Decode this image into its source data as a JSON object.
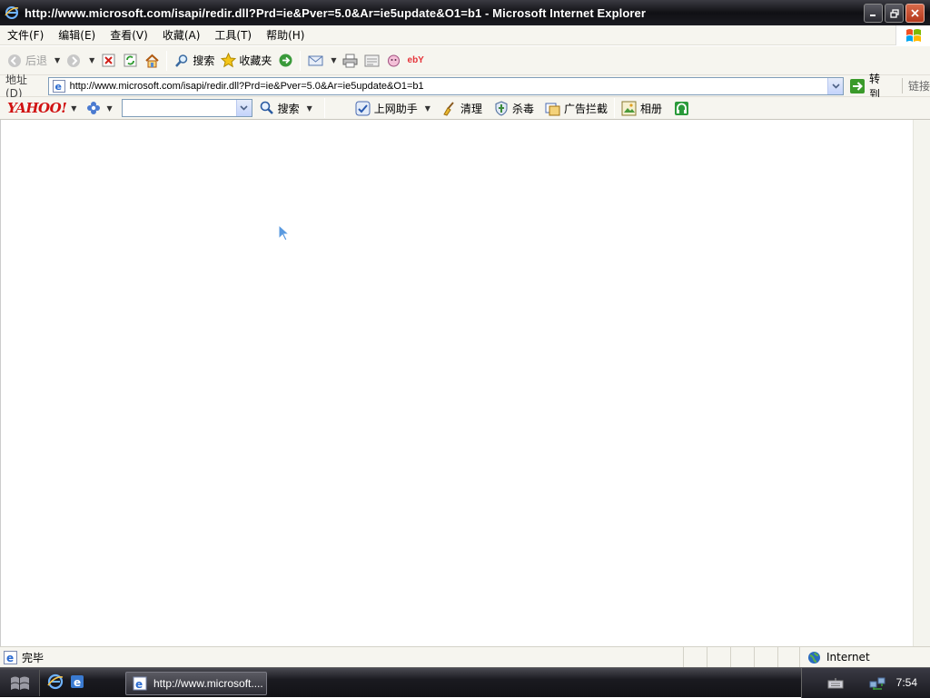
{
  "window": {
    "title": "http://www.microsoft.com/isapi/redir.dll?Prd=ie&Pver=5.0&Ar=ie5update&O1=b1 - Microsoft Internet Explorer",
    "controls": [
      "minimize",
      "maximize",
      "close"
    ]
  },
  "menu": {
    "items": [
      "文件(F)",
      "编辑(E)",
      "查看(V)",
      "收藏(A)",
      "工具(T)",
      "帮助(H)"
    ]
  },
  "toolbar": {
    "back_label": "后退",
    "search_label": "搜索",
    "favorites_label": "收藏夹",
    "ebay_label": "ebY"
  },
  "address": {
    "label": "地址(D)",
    "url": "http://www.microsoft.com/isapi/redir.dll?Prd=ie&Pver=5.0&Ar=ie5update&O1=b1",
    "go_label": "转到",
    "links_label": "链接"
  },
  "yahoo_bar": {
    "logo": "YAHOO!",
    "search_value": "",
    "search_label": "搜索",
    "assistant_label": "上网助手",
    "clean_label": "清理",
    "antivirus_label": "杀毒",
    "adblock_label": "广告拦截",
    "album_label": "相册"
  },
  "status": {
    "text": "完毕",
    "zone": "Internet"
  },
  "taskbar": {
    "task_label": "http://www.microsoft....",
    "clock": "7:54"
  },
  "colors": {
    "title_bar": "#1b1b21",
    "toolbar_bg": "#f6f5ef",
    "yahoo_red": "#d01111",
    "address_border": "#7f9db9"
  }
}
